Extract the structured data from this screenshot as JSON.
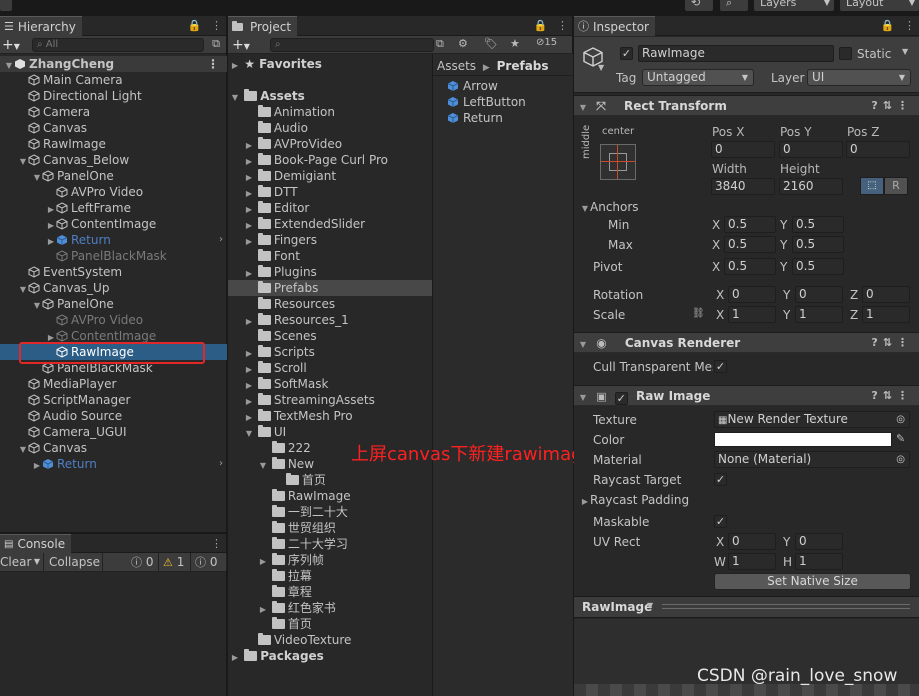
{
  "topbar": {
    "history_label": "",
    "search_label": "",
    "layers_label": "Layers",
    "layout_label": "Layout"
  },
  "hierarchy": {
    "tab": "Hierarchy",
    "search_placeholder": "All",
    "add_label": "+",
    "items": [
      {
        "label": "ZhangCheng",
        "indent": 0,
        "arrow": "▼",
        "icon": "scene",
        "state": "root"
      },
      {
        "label": "Main Camera",
        "indent": 1,
        "arrow": "",
        "icon": "cube",
        "state": ""
      },
      {
        "label": "Directional Light",
        "indent": 1,
        "arrow": "",
        "icon": "cube",
        "state": ""
      },
      {
        "label": "Camera",
        "indent": 1,
        "arrow": "",
        "icon": "cube",
        "state": ""
      },
      {
        "label": "Canvas",
        "indent": 1,
        "arrow": "",
        "icon": "cube",
        "state": ""
      },
      {
        "label": "RawImage",
        "indent": 1,
        "arrow": "",
        "icon": "cube",
        "state": ""
      },
      {
        "label": "Canvas_Below",
        "indent": 1,
        "arrow": "▼",
        "icon": "cube",
        "state": ""
      },
      {
        "label": "PanelOne",
        "indent": 2,
        "arrow": "▼",
        "icon": "cube",
        "state": ""
      },
      {
        "label": "AVPro Video",
        "indent": 3,
        "arrow": "",
        "icon": "cube",
        "state": ""
      },
      {
        "label": "LeftFrame",
        "indent": 3,
        "arrow": "▶",
        "icon": "cube",
        "state": ""
      },
      {
        "label": "ContentImage",
        "indent": 3,
        "arrow": "▶",
        "icon": "cube",
        "state": ""
      },
      {
        "label": "Return",
        "indent": 3,
        "arrow": "▶",
        "icon": "prefab",
        "state": "blue"
      },
      {
        "label": "PanelBlackMask",
        "indent": 3,
        "arrow": "",
        "icon": "cube",
        "state": "dim"
      },
      {
        "label": "EventSystem",
        "indent": 1,
        "arrow": "",
        "icon": "cube",
        "state": ""
      },
      {
        "label": "Canvas_Up",
        "indent": 1,
        "arrow": "▼",
        "icon": "cube",
        "state": ""
      },
      {
        "label": "PanelOne",
        "indent": 2,
        "arrow": "▼",
        "icon": "cube",
        "state": ""
      },
      {
        "label": "AVPro Video",
        "indent": 3,
        "arrow": "",
        "icon": "cube",
        "state": "dim"
      },
      {
        "label": "ContentImage",
        "indent": 3,
        "arrow": "▶",
        "icon": "cube",
        "state": "dim"
      },
      {
        "label": "RawImage",
        "indent": 3,
        "arrow": "",
        "icon": "cube",
        "state": "sel"
      },
      {
        "label": "PanelBlackMask",
        "indent": 2,
        "arrow": "",
        "icon": "cube",
        "state": ""
      },
      {
        "label": "MediaPlayer",
        "indent": 1,
        "arrow": "",
        "icon": "cube",
        "state": ""
      },
      {
        "label": "ScriptManager",
        "indent": 1,
        "arrow": "",
        "icon": "cube",
        "state": ""
      },
      {
        "label": "Audio Source",
        "indent": 1,
        "arrow": "",
        "icon": "cube",
        "state": ""
      },
      {
        "label": "Camera_UGUI",
        "indent": 1,
        "arrow": "",
        "icon": "cube",
        "state": ""
      },
      {
        "label": "Canvas",
        "indent": 1,
        "arrow": "▼",
        "icon": "cube",
        "state": ""
      },
      {
        "label": "Return",
        "indent": 2,
        "arrow": "▶",
        "icon": "prefab",
        "state": "blue"
      }
    ]
  },
  "console": {
    "tab": "Console",
    "clear_label": "Clear",
    "collapse_label": "Collapse",
    "log_count": "0",
    "warn_count": "1",
    "error_count": "0"
  },
  "project": {
    "tab": "Project",
    "add_label": "+",
    "hidden_count": "15",
    "favorites_label": "Favorites",
    "assets_label": "Assets",
    "packages_label": "Packages",
    "folders": [
      {
        "label": "Animation",
        "indent": 1,
        "arrow": "",
        "open": false
      },
      {
        "label": "Audio",
        "indent": 1,
        "arrow": "",
        "open": false
      },
      {
        "label": "AVProVideo",
        "indent": 1,
        "arrow": "▶",
        "open": false
      },
      {
        "label": "Book-Page Curl Pro",
        "indent": 1,
        "arrow": "▶",
        "open": false
      },
      {
        "label": "Demigiant",
        "indent": 1,
        "arrow": "▶",
        "open": false
      },
      {
        "label": "DTT",
        "indent": 1,
        "arrow": "▶",
        "open": false
      },
      {
        "label": "Editor",
        "indent": 1,
        "arrow": "▶",
        "open": false
      },
      {
        "label": "ExtendedSlider",
        "indent": 1,
        "arrow": "▶",
        "open": false
      },
      {
        "label": "Fingers",
        "indent": 1,
        "arrow": "▶",
        "open": false
      },
      {
        "label": "Font",
        "indent": 1,
        "arrow": "",
        "open": false
      },
      {
        "label": "Plugins",
        "indent": 1,
        "arrow": "▶",
        "open": false
      },
      {
        "label": "Prefabs",
        "indent": 1,
        "arrow": "",
        "open": false,
        "selected": true
      },
      {
        "label": "Resources",
        "indent": 1,
        "arrow": "",
        "open": false
      },
      {
        "label": "Resources_1",
        "indent": 1,
        "arrow": "▶",
        "open": false
      },
      {
        "label": "Scenes",
        "indent": 1,
        "arrow": "",
        "open": false
      },
      {
        "label": "Scripts",
        "indent": 1,
        "arrow": "▶",
        "open": false
      },
      {
        "label": "Scroll",
        "indent": 1,
        "arrow": "▶",
        "open": false
      },
      {
        "label": "SoftMask",
        "indent": 1,
        "arrow": "▶",
        "open": false
      },
      {
        "label": "StreamingAssets",
        "indent": 1,
        "arrow": "▶",
        "open": false
      },
      {
        "label": "TextMesh Pro",
        "indent": 1,
        "arrow": "▶",
        "open": false
      },
      {
        "label": "UI",
        "indent": 1,
        "arrow": "▼",
        "open": true
      },
      {
        "label": "222",
        "indent": 2,
        "arrow": "",
        "open": false
      },
      {
        "label": "New",
        "indent": 2,
        "arrow": "▼",
        "open": true
      },
      {
        "label": "首页",
        "indent": 3,
        "arrow": "",
        "open": false
      },
      {
        "label": "RawImage",
        "indent": 2,
        "arrow": "",
        "open": false
      },
      {
        "label": "一到二十大",
        "indent": 2,
        "arrow": "",
        "open": false
      },
      {
        "label": "世贸组织",
        "indent": 2,
        "arrow": "",
        "open": false
      },
      {
        "label": "二十大学习",
        "indent": 2,
        "arrow": "",
        "open": false
      },
      {
        "label": "序列帧",
        "indent": 2,
        "arrow": "▶",
        "open": false
      },
      {
        "label": "拉幕",
        "indent": 2,
        "arrow": "",
        "open": false
      },
      {
        "label": "章程",
        "indent": 2,
        "arrow": "",
        "open": false
      },
      {
        "label": "红色家书",
        "indent": 2,
        "arrow": "▶",
        "open": false
      },
      {
        "label": "首页",
        "indent": 2,
        "arrow": "",
        "open": false
      },
      {
        "label": "VideoTexture",
        "indent": 1,
        "arrow": "",
        "open": false
      }
    ],
    "breadcrumb": [
      "Assets",
      "Prefabs"
    ],
    "breadcrumb_sep": "▶",
    "prefabs": [
      "Arrow",
      "LeftButton",
      "Return"
    ]
  },
  "annotation": {
    "text": "上屏canvas下新建rawimage",
    "color": "#ff2020"
  },
  "inspector": {
    "tab": "Inspector",
    "object_name": "RawImage",
    "static_label": "Static",
    "tag_label": "Tag",
    "tag_value": "Untagged",
    "layer_label": "Layer",
    "layer_value": "UI",
    "rect_transform": {
      "title": "Rect Transform",
      "anchor_h": "center",
      "anchor_v": "middle",
      "pos_x_label": "Pos X",
      "pos_x": "0",
      "pos_y_label": "Pos Y",
      "pos_y": "0",
      "pos_z_label": "Pos Z",
      "pos_z": "0",
      "width_label": "Width",
      "width": "3840",
      "height_label": "Height",
      "height": "2160",
      "r_label": "R",
      "anchors_label": "Anchors",
      "min_label": "Min",
      "min_x": "0.5",
      "min_y": "0.5",
      "max_label": "Max",
      "max_x": "0.5",
      "max_y": "0.5",
      "pivot_label": "Pivot",
      "pivot_x": "0.5",
      "pivot_y": "0.5",
      "rotation_label": "Rotation",
      "rot_x": "0",
      "rot_y": "0",
      "rot_z": "0",
      "scale_label": "Scale",
      "scale_x": "1",
      "scale_y": "1",
      "scale_z": "1"
    },
    "canvas_renderer": {
      "title": "Canvas Renderer",
      "cull_label": "Cull Transparent Mes"
    },
    "raw_image": {
      "title": "Raw Image",
      "texture_label": "Texture",
      "texture_value": "New Render Texture",
      "color_label": "Color",
      "color_value": "#ffffff",
      "material_label": "Material",
      "material_value": "None (Material)",
      "raycast_target_label": "Raycast Target",
      "raycast_padding_label": "Raycast Padding",
      "maskable_label": "Maskable",
      "uv_rect_label": "UV Rect",
      "uv_x": "0",
      "uv_y": "0",
      "uv_w": "1",
      "uv_h": "1",
      "native_size_label": "Set Native Size"
    },
    "preview_label": "RawImage"
  },
  "watermark": "CSDN @rain_love_snow",
  "colors": {
    "selection": "#2c5d87",
    "prefab_blue": "#4f7fc4",
    "panel": "#282828",
    "field": "#2a2a2a"
  }
}
